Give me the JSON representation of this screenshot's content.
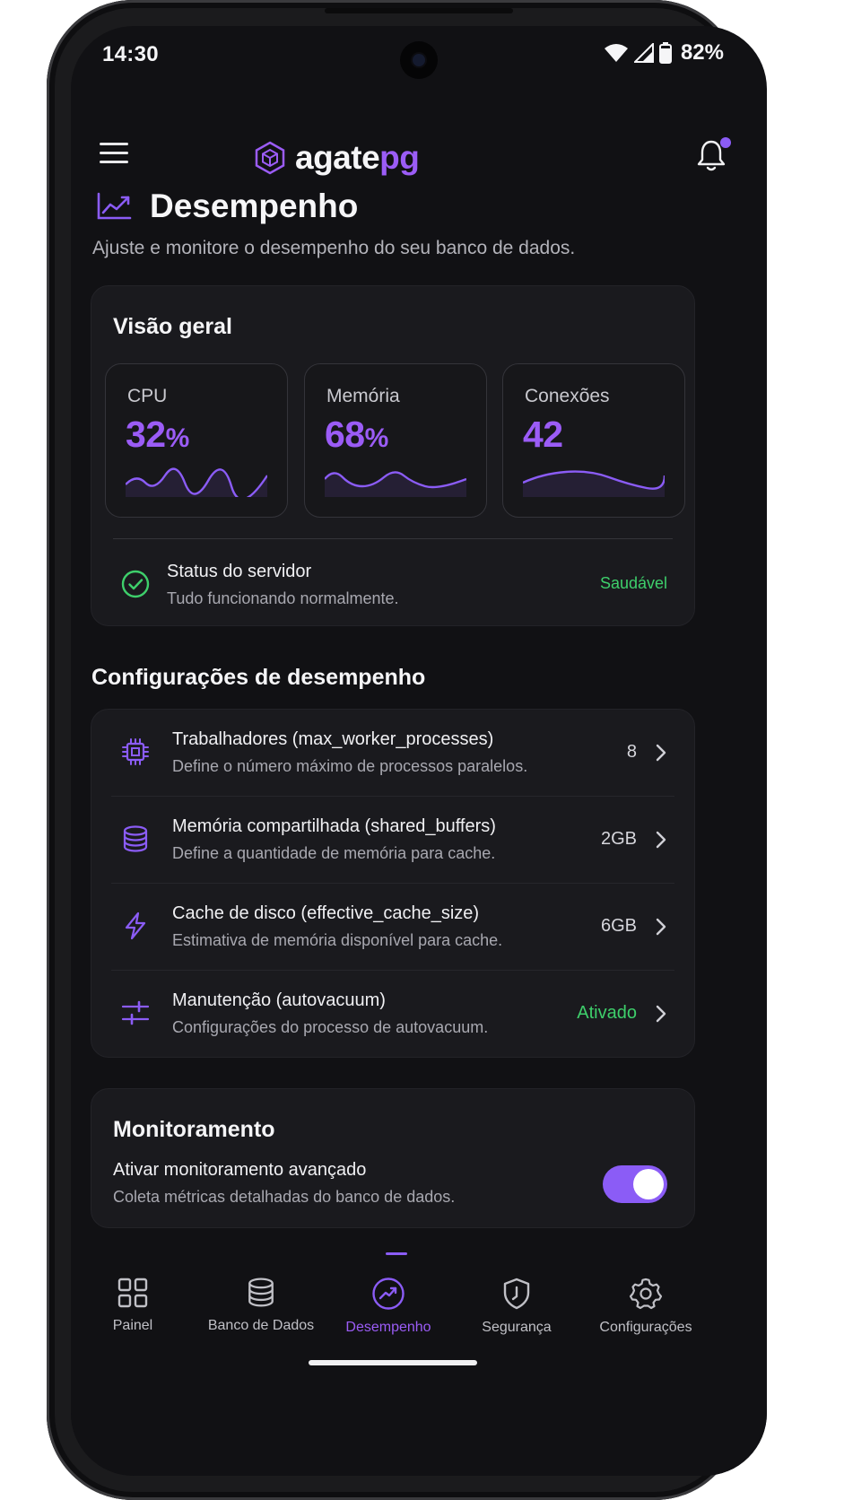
{
  "status_bar": {
    "time": "14:30",
    "battery": "82%"
  },
  "app": {
    "logo_part1": "agate",
    "logo_part2": "pg"
  },
  "page": {
    "title": "Desempenho",
    "subtitle": "Ajuste e monitore o desempenho do seu banco de dados."
  },
  "overview": {
    "title": "Visão geral",
    "metrics": [
      {
        "label": "CPU",
        "value": "32",
        "unit": "%"
      },
      {
        "label": "Memória",
        "value": "68",
        "unit": "%"
      },
      {
        "label": "Conexões",
        "value": "42",
        "unit": ""
      }
    ],
    "server": {
      "title": "Status do servidor",
      "subtitle": "Tudo funcionando normalmente.",
      "badge": "Saudável"
    }
  },
  "settings": {
    "title": "Configurações de desempenho",
    "items": [
      {
        "icon": "cpu-chip-icon",
        "title": "Trabalhadores (max_worker_processes)",
        "subtitle": "Define o número máximo de processos paralelos.",
        "value": "8"
      },
      {
        "icon": "database-icon",
        "title": "Memória compartilhada (shared_buffers)",
        "subtitle": "Define a quantidade de memória para cache.",
        "value": "2GB"
      },
      {
        "icon": "lightning-icon",
        "title": "Cache de disco (effective_cache_size)",
        "subtitle": "Estimativa de memória disponível para cache.",
        "value": "6GB"
      },
      {
        "icon": "sliders-icon",
        "title": "Manutenção (autovacuum)",
        "subtitle": "Configurações do processo de autovacuum.",
        "value": "Ativado"
      }
    ]
  },
  "monitoring": {
    "title": "Monitoramento",
    "option_title": "Ativar monitoramento avançado",
    "option_subtitle": "Coleta métricas detalhadas do banco de dados.",
    "enabled": true
  },
  "nav": [
    {
      "label": "Painel",
      "icon": "grid-icon"
    },
    {
      "label": "Banco de Dados",
      "icon": "database-icon"
    },
    {
      "label": "Desempenho",
      "icon": "performance-icon",
      "active": true
    },
    {
      "label": "Segurança",
      "icon": "shield-icon"
    },
    {
      "label": "Configurações",
      "icon": "gear-icon"
    }
  ],
  "colors": {
    "accent": "#8b5cf6",
    "success": "#3ecf6b",
    "background": "#111114",
    "card": "#1a1a1e"
  }
}
